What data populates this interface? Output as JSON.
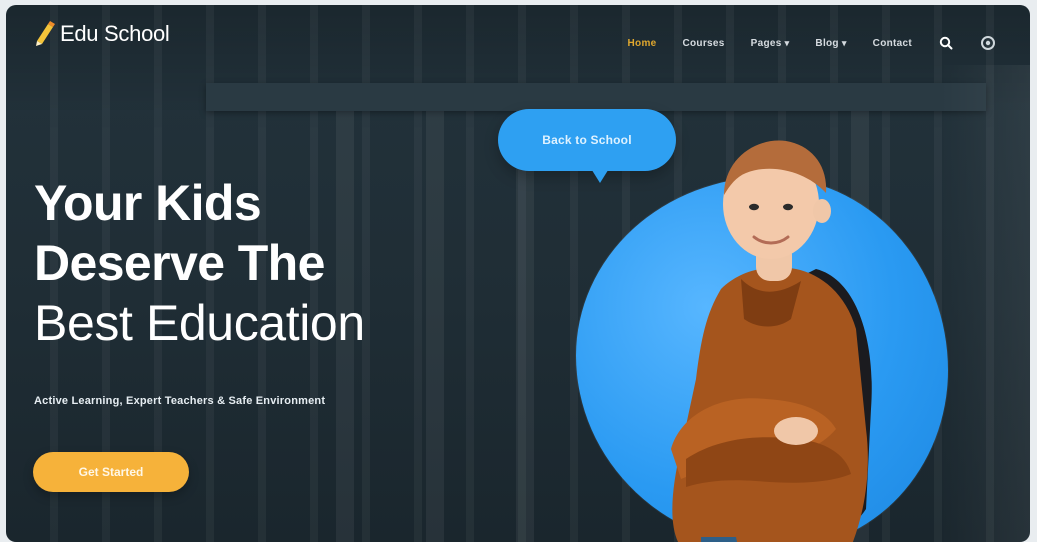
{
  "brand": {
    "name": "Edu School"
  },
  "nav": {
    "items": [
      {
        "label": "Home",
        "active": true
      },
      {
        "label": "Courses",
        "active": false
      },
      {
        "label": "Pages",
        "has_dropdown": true
      },
      {
        "label": "Blog",
        "has_dropdown": true
      },
      {
        "label": "Contact",
        "active": false
      }
    ],
    "icons": [
      "search-icon",
      "settings-icon"
    ]
  },
  "hero": {
    "title_line1": "Your Kids",
    "title_line2": "Deserve The",
    "title_line3": "Best Education",
    "subtitle": "Active Learning, Expert Teachers & Safe Environment",
    "cta_label": "Get Started",
    "bubble_text": "Back to School"
  },
  "colors": {
    "accent_yellow": "#f6b23a",
    "accent_blue": "#2ea0f2",
    "background": "#21303a",
    "text": "#ffffff"
  }
}
